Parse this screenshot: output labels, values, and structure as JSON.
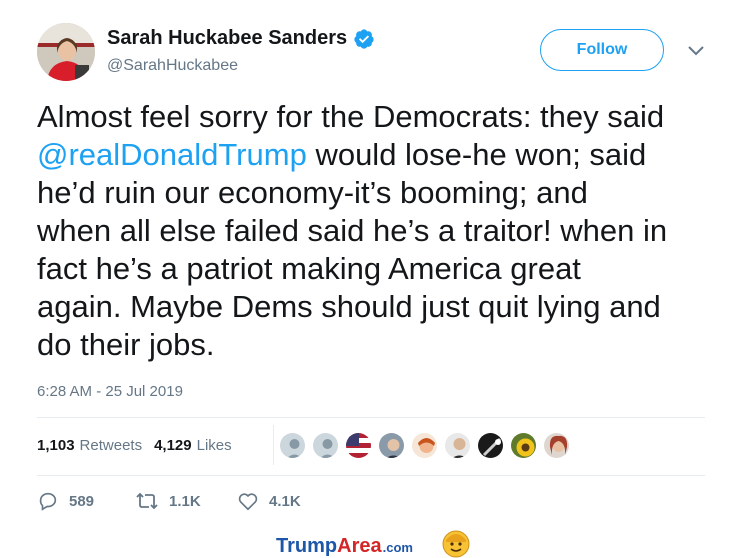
{
  "user": {
    "display_name": "Sarah Huckabee Sanders",
    "handle": "@SarahHuckabee",
    "avatar": "avatar",
    "verified_icon": "verified-badge-icon"
  },
  "follow_label": "Follow",
  "tweet": {
    "lines": [
      "Almost feel sorry for the Democrats: they said",
      "would lose-he won; said",
      "he’d ruin our economy-it’s booming; and",
      "when all else failed said he’s a traitor! when in",
      "fact he’s a patriot making America great",
      "again. Maybe Dems should just quit lying and",
      "do their jobs."
    ],
    "mention": "@realDonaldTrump"
  },
  "timestamp": "6:28 AM - 25 Jul 2019",
  "stats": {
    "retweets_count": "1,103",
    "retweets_label": "Retweets",
    "likes_count": "4,129",
    "likes_label": "Likes"
  },
  "actions": {
    "replies": "589",
    "retweets": "1.1K",
    "likes": "4.1K"
  },
  "footer": {
    "trump": "Trump",
    "area": "Area",
    "com": ".com"
  },
  "colors": {
    "accent": "#1da1f2",
    "text": "#14171a",
    "muted": "#657786",
    "divider": "#e6ecf0"
  }
}
